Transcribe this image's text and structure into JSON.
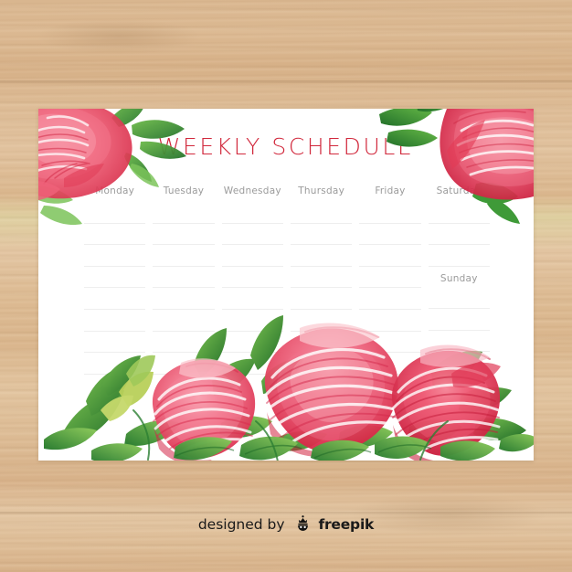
{
  "background": {
    "surface": "wood-table",
    "wood_color": "#dcba93",
    "grain_color": "#a9784c"
  },
  "card": {
    "background_color": "#ffffff",
    "title": "WEEKLY SCHEDULE",
    "title_color": "#d1283c",
    "rule_color": "#eeeeee",
    "label_color": "#9b9b9b",
    "columns": [
      {
        "day": "Monday",
        "lines_before": 0,
        "lines_after": 8
      },
      {
        "day": "Tuesday",
        "lines_before": 0,
        "lines_after": 8
      },
      {
        "day": "Wednesday",
        "lines_before": 0,
        "lines_after": 8
      },
      {
        "day": "Thursday",
        "lines_before": 0,
        "lines_after": 8
      },
      {
        "day": "Friday",
        "lines_before": 0,
        "lines_after": 8
      },
      {
        "day": "Saturday",
        "lines_before": 0,
        "lines_after": 3,
        "second_day": "Sunday",
        "lines_after_second": 3
      }
    ]
  },
  "decoration": {
    "style": "watercolor-peony",
    "flower_pink_light": "#f4899b",
    "flower_pink": "#ef5d75",
    "flower_red": "#e23b54",
    "flower_crimson": "#cf2240",
    "leaf_green_light": "#8cc059",
    "leaf_green": "#46a03f",
    "leaf_green_dark": "#2e7d32",
    "placements": [
      "top-left-corner",
      "top-right-corner",
      "bottom-edge-bouquet"
    ]
  },
  "credit": {
    "prefix": "designed by",
    "brand": "freepik",
    "logo": "freepik-crown-icon"
  }
}
